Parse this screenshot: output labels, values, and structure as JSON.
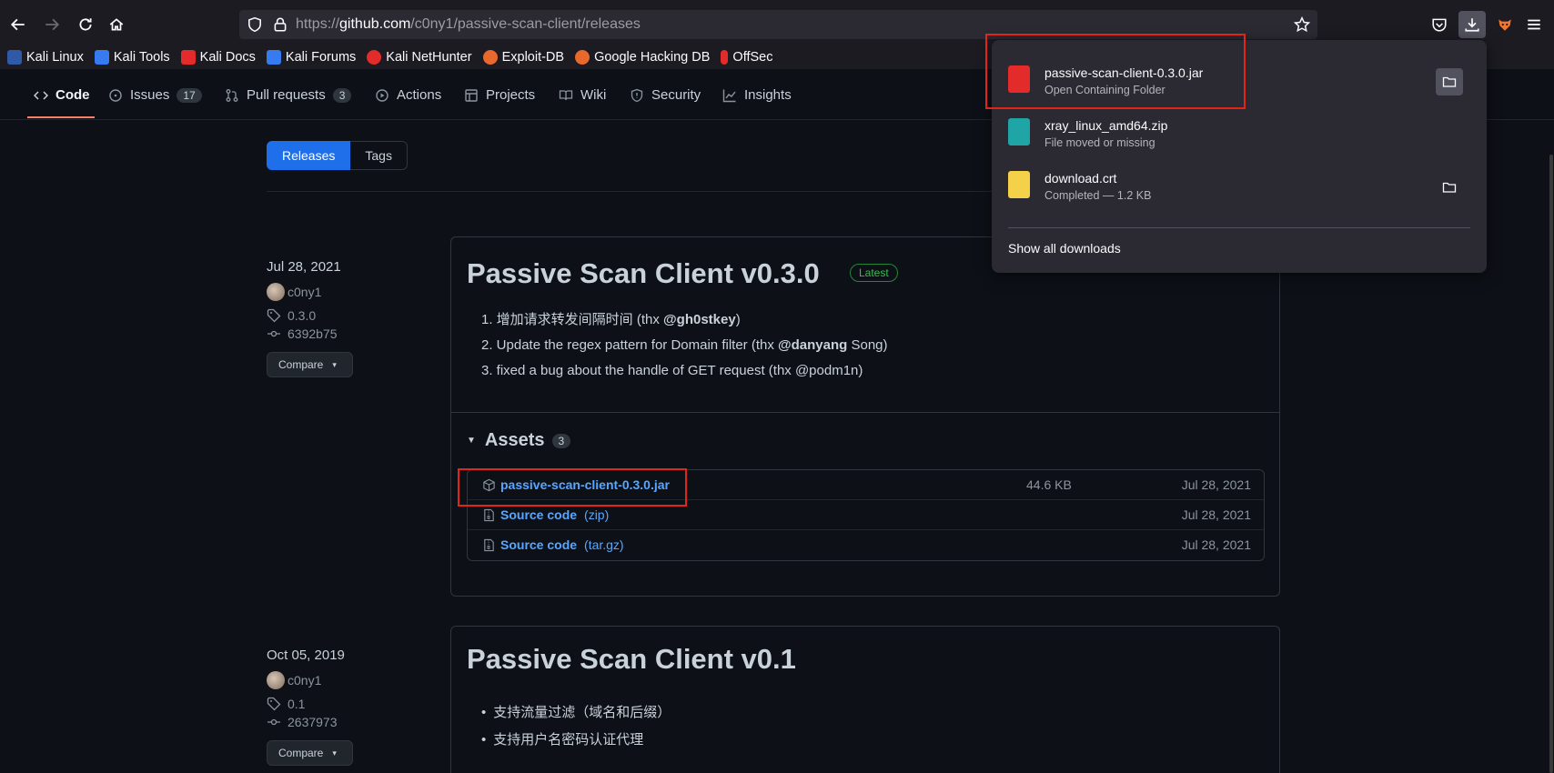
{
  "browser": {
    "url_prefix": "https://",
    "url_domain": "github.com",
    "url_path": "/c0ny1/passive-scan-client/releases",
    "bookmarks": [
      {
        "label": "Kali Linux",
        "icon": "kali-dragon-icon",
        "color": "#367bf0"
      },
      {
        "label": "Kali Tools",
        "icon": "kali-tools-icon",
        "color": "#367bf0"
      },
      {
        "label": "Kali Docs",
        "icon": "kali-docs-icon",
        "color": "#e32b2b"
      },
      {
        "label": "Kali Forums",
        "icon": "kali-forums-icon",
        "color": "#367bf0"
      },
      {
        "label": "Kali NetHunter",
        "icon": "nethunter-icon",
        "color": "#e32b2b"
      },
      {
        "label": "Exploit-DB",
        "icon": "exploit-db-icon",
        "color": "#e8692b"
      },
      {
        "label": "Google Hacking DB",
        "icon": "ghdb-icon",
        "color": "#e8692b"
      },
      {
        "label": "OffSec",
        "icon": "offsec-icon",
        "color": "#e32b2b"
      }
    ]
  },
  "repo_nav": {
    "code": "Code",
    "issues": "Issues",
    "issues_count": "17",
    "pulls": "Pull requests",
    "pulls_count": "3",
    "actions": "Actions",
    "projects": "Projects",
    "wiki": "Wiki",
    "security": "Security",
    "insights": "Insights"
  },
  "subnav": {
    "releases": "Releases",
    "tags": "Tags"
  },
  "releases": [
    {
      "date": "Jul 28, 2021",
      "author": "c0ny1",
      "tag": "0.3.0",
      "commit": "6392b75",
      "compare": "Compare",
      "title": "Passive Scan Client v0.3.0",
      "badge": "Latest",
      "notes": [
        {
          "pre": "1. 增加请求转发间隔时间 (thx ",
          "bold": "@gh0stkey",
          "post": ")"
        },
        {
          "pre": "2. Update the regex pattern for Domain filter (thx ",
          "bold": "@danyang",
          "post": " Song)"
        },
        {
          "pre": "3. fixed a bug about the handle of GET request (thx @podm1n)",
          "bold": "",
          "post": ""
        }
      ],
      "assets_title": "Assets",
      "assets_count": "3",
      "assets": [
        {
          "name": "passive-scan-client-0.3.0.jar",
          "ext": "",
          "size": "44.6 KB",
          "date": "Jul 28, 2021"
        },
        {
          "name": "Source code",
          "ext": "(zip)",
          "size": "",
          "date": "Jul 28, 2021"
        },
        {
          "name": "Source code",
          "ext": "(tar.gz)",
          "size": "",
          "date": "Jul 28, 2021"
        }
      ]
    },
    {
      "date": "Oct 05, 2019",
      "author": "c0ny1",
      "tag": "0.1",
      "commit": "2637973",
      "compare": "Compare",
      "title": "Passive Scan Client v0.1",
      "bullets": [
        "支持流量过滤（域名和后缀）",
        "支持用户名密码认证代理"
      ]
    }
  ],
  "downloads": {
    "items": [
      {
        "name": "passive-scan-client-0.3.0.jar",
        "status": "Open Containing Folder",
        "icon": "java-file-icon",
        "color": "#e32b2b"
      },
      {
        "name": "xray_linux_amd64.zip",
        "status": "File moved or missing",
        "icon": "zip-file-icon",
        "color": "#1fa5a5"
      },
      {
        "name": "download.crt",
        "status": "Completed — 1.2 KB",
        "icon": "certificate-file-icon",
        "color": "#f5d14a"
      }
    ],
    "show_all": "Show all downloads"
  }
}
